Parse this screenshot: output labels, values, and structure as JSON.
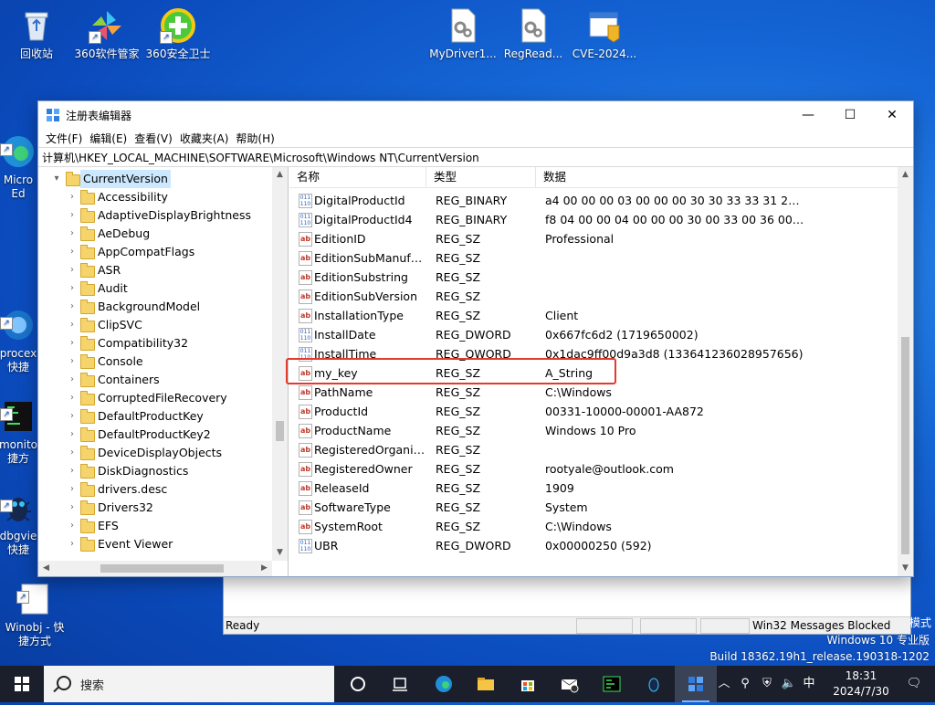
{
  "desktop_icons": [
    {
      "label": "回收站",
      "icon": "recycle-bin-icon",
      "shortcut": false
    },
    {
      "label": "360软件管家",
      "icon": "360-software-manager-icon",
      "shortcut": true
    },
    {
      "label": "360安全卫士",
      "icon": "360-security-icon",
      "shortcut": true
    },
    {
      "label": "MyDriver1...",
      "icon": "driver-file-icon",
      "shortcut": false
    },
    {
      "label": "RegRead...",
      "icon": "driver-file-icon",
      "shortcut": false
    },
    {
      "label": "CVE-2024...",
      "icon": "app-window-icon",
      "shortcut": false
    },
    {
      "label": "Micro\nEd",
      "icon": "edge-icon",
      "shortcut": true
    },
    {
      "label": "procex\n快捷",
      "icon": "procexp-icon",
      "shortcut": true
    },
    {
      "label": "monito\n捷方",
      "icon": "monitor-icon",
      "shortcut": true
    },
    {
      "label": "dbgvie\n快捷",
      "icon": "debugview-icon",
      "shortcut": true
    },
    {
      "label": "Winobj - 快\n捷方式",
      "icon": "winobj-icon",
      "shortcut": true
    }
  ],
  "window": {
    "title": "注册表编辑器",
    "menu": [
      "文件(F)",
      "编辑(E)",
      "查看(V)",
      "收藏夹(A)",
      "帮助(H)"
    ],
    "address": "计算机\\HKEY_LOCAL_MACHINE\\SOFTWARE\\Microsoft\\Windows NT\\CurrentVersion",
    "controls": {
      "minimize": "—",
      "maximize": "☐",
      "close": "✕"
    }
  },
  "tree": {
    "selected": "CurrentVersion",
    "children": [
      "Accessibility",
      "AdaptiveDisplayBrightness",
      "AeDebug",
      "AppCompatFlags",
      "ASR",
      "Audit",
      "BackgroundModel",
      "ClipSVC",
      "Compatibility32",
      "Console",
      "Containers",
      "CorruptedFileRecovery",
      "DefaultProductKey",
      "DefaultProductKey2",
      "DeviceDisplayObjects",
      "DiskDiagnostics",
      "drivers.desc",
      "Drivers32",
      "EFS",
      "Event Viewer"
    ]
  },
  "list": {
    "columns": [
      "名称",
      "类型",
      "数据"
    ],
    "rows": [
      {
        "name": "DigitalProductId",
        "type": "REG_BINARY",
        "data": "a4 00 00 00 03 00 00 00 30 30 33 33 31 2d 31...",
        "kind": "bin"
      },
      {
        "name": "DigitalProductId4",
        "type": "REG_BINARY",
        "data": "f8 04 00 00 04 00 00 00 30 00 33 00 36 00 31 ...",
        "kind": "bin"
      },
      {
        "name": "EditionID",
        "type": "REG_SZ",
        "data": "Professional",
        "kind": "sz"
      },
      {
        "name": "EditionSubManufact...",
        "type": "REG_SZ",
        "data": "",
        "kind": "sz"
      },
      {
        "name": "EditionSubstring",
        "type": "REG_SZ",
        "data": "",
        "kind": "sz"
      },
      {
        "name": "EditionSubVersion",
        "type": "REG_SZ",
        "data": "",
        "kind": "sz"
      },
      {
        "name": "InstallationType",
        "type": "REG_SZ",
        "data": "Client",
        "kind": "sz"
      },
      {
        "name": "InstallDate",
        "type": "REG_DWORD",
        "data": "0x667fc6d2 (1719650002)",
        "kind": "bin"
      },
      {
        "name": "InstallTime",
        "type": "REG_QWORD",
        "data": "0x1dac9ff00d9a3d8 (133641236028957656)",
        "kind": "bin"
      },
      {
        "name": "my_key",
        "type": "REG_SZ",
        "data": "A_String",
        "kind": "sz"
      },
      {
        "name": "PathName",
        "type": "REG_SZ",
        "data": "C:\\Windows",
        "kind": "sz"
      },
      {
        "name": "ProductId",
        "type": "REG_SZ",
        "data": "00331-10000-00001-AA872",
        "kind": "sz"
      },
      {
        "name": "ProductName",
        "type": "REG_SZ",
        "data": "Windows 10 Pro",
        "kind": "sz"
      },
      {
        "name": "RegisteredOrganiza...",
        "type": "REG_SZ",
        "data": "",
        "kind": "sz"
      },
      {
        "name": "RegisteredOwner",
        "type": "REG_SZ",
        "data": "rootyale@outlook.com",
        "kind": "sz"
      },
      {
        "name": "ReleaseId",
        "type": "REG_SZ",
        "data": "1909",
        "kind": "sz"
      },
      {
        "name": "SoftwareType",
        "type": "REG_SZ",
        "data": "System",
        "kind": "sz"
      },
      {
        "name": "SystemRoot",
        "type": "REG_SZ",
        "data": "C:\\Windows",
        "kind": "sz"
      },
      {
        "name": "UBR",
        "type": "REG_DWORD",
        "data": "0x00000250 (592)",
        "kind": "bin"
      }
    ]
  },
  "background_window": {
    "status": "Ready",
    "messages": "Win32 Messages Blocked",
    "right_edge_text": "模式"
  },
  "watermark": {
    "line1": "Windows 10 专业版",
    "line2": "Build 18362.19h1_release.190318-1202"
  },
  "taskbar": {
    "search_placeholder": "搜索",
    "ime": "中",
    "time": "18:31",
    "date": "2024/7/30",
    "colors": {
      "accent": "#7db6ff",
      "taskbar": "#1a1f2b"
    }
  }
}
